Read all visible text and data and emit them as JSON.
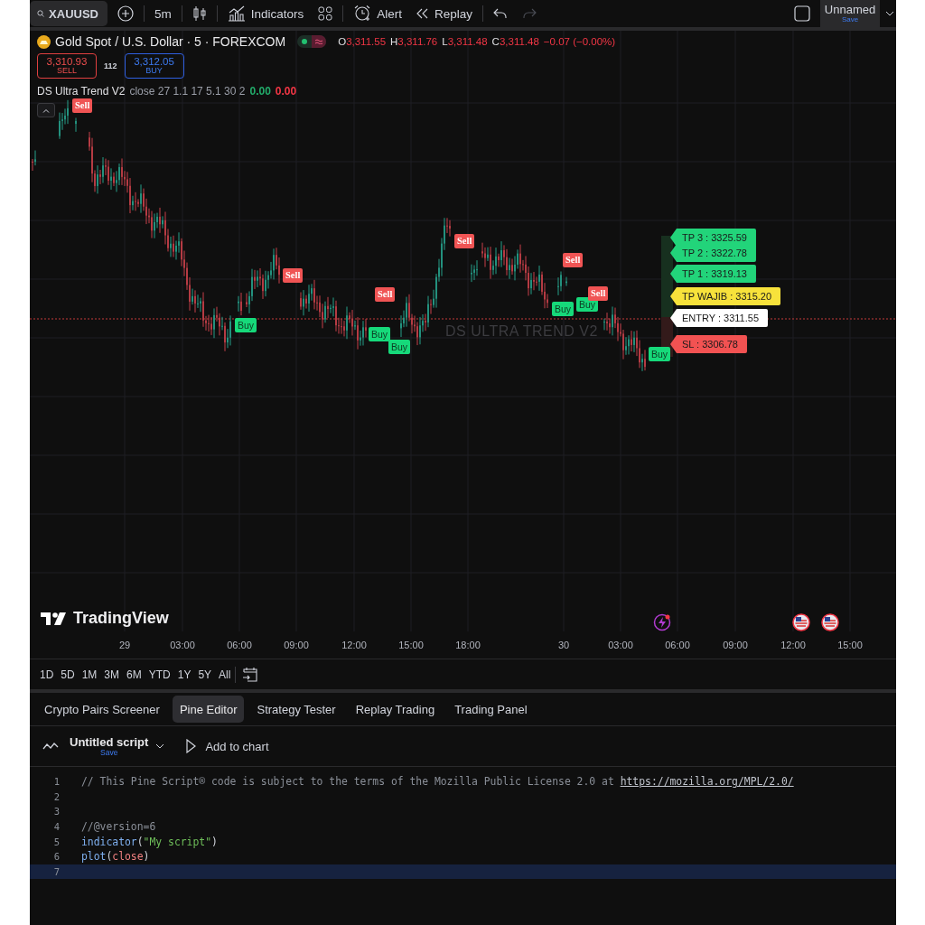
{
  "toolbar": {
    "symbol": "XAUUSD",
    "interval": "5m",
    "indicators": "Indicators",
    "alert": "Alert",
    "replay": "Replay",
    "redo_disabled": true,
    "layout_name": "Unnamed",
    "layout_save": "Save"
  },
  "legend": {
    "title": "Gold Spot / U.S. Dollar · 5 · FOREXCOM",
    "ohlc": [
      {
        "label": "O",
        "value": "3,311.55"
      },
      {
        "label": "H",
        "value": "3,311.76"
      },
      {
        "label": "L",
        "value": "3,311.48"
      },
      {
        "label": "C",
        "value": "3,311.48"
      }
    ],
    "change": "−0.07 (−0.00%)"
  },
  "trade": {
    "sell_price": "3,310.93",
    "sell_label": "SELL",
    "spread": "112",
    "buy_price": "3,312.05",
    "buy_label": "BUY"
  },
  "indicator": {
    "name": "DS Ultra Trend V2",
    "params": "close 27 1.1 17 5.1 30 2",
    "values": [
      {
        "text": "0.00",
        "color": "#22ab6a"
      },
      {
        "text": "0.00",
        "color": "#f23645"
      }
    ]
  },
  "chart": {
    "watermark": "DS ULTRA TREND V2",
    "brand": "TradingView",
    "signals": [
      {
        "kind": "sell",
        "label": "Sell"
      },
      {
        "kind": "buy",
        "label": "Buy"
      },
      {
        "kind": "sell",
        "label": "Sell"
      },
      {
        "kind": "buy",
        "label": "Buy"
      },
      {
        "kind": "sell",
        "label": "Sell"
      },
      {
        "kind": "buy",
        "label": "Buy"
      },
      {
        "kind": "sell",
        "label": "Sell"
      },
      {
        "kind": "buy",
        "label": "Buy"
      },
      {
        "kind": "sell",
        "label": "Sell"
      },
      {
        "kind": "buy",
        "label": "Buy"
      },
      {
        "kind": "sell",
        "label": "Sell"
      },
      {
        "kind": "buy",
        "label": "Buy"
      }
    ],
    "levels": [
      {
        "label": "TP 3 : 3325.59",
        "color": "#22d47a"
      },
      {
        "label": "TP 2 : 3322.78",
        "color": "#22d47a"
      },
      {
        "label": "TP 1 : 3319.13",
        "color": "#22d47a"
      },
      {
        "label": "TP WAJIB : 3315.20",
        "color": "#f7e23b"
      },
      {
        "label": "ENTRY : 3311.55",
        "color": "#ffffff"
      },
      {
        "label": "SL : 3306.78",
        "color": "#f25252"
      }
    ],
    "time_axis": [
      "29",
      "03:00",
      "06:00",
      "09:00",
      "12:00",
      "15:00",
      "18:00",
      "30",
      "03:00",
      "06:00",
      "09:00",
      "12:00",
      "15:00"
    ]
  },
  "ranges": [
    "1D",
    "5D",
    "1M",
    "3M",
    "6M",
    "YTD",
    "1Y",
    "5Y",
    "All"
  ],
  "panel_tabs": [
    {
      "label": "Crypto Pairs Screener",
      "selected": false
    },
    {
      "label": "Pine Editor",
      "selected": true
    },
    {
      "label": "Strategy Tester",
      "selected": false
    },
    {
      "label": "Replay Trading",
      "selected": false
    },
    {
      "label": "Trading Panel",
      "selected": false
    }
  ],
  "script": {
    "name": "Untitled script",
    "save": "Save",
    "add": "Add to chart"
  },
  "code": [
    {
      "number": "1",
      "active": false,
      "tokens": [
        {
          "kind": "comment",
          "text": "// This Pine Script® code is subject to the terms of the Mozilla Public License 2.0 at "
        },
        {
          "kind": "link",
          "text": "https://mozilla.org/MPL/2.0/"
        }
      ]
    },
    {
      "number": "2",
      "active": false
    },
    {
      "number": "3",
      "active": false
    },
    {
      "number": "4",
      "active": false,
      "tokens": [
        {
          "kind": "comment",
          "text": "//@version=6"
        }
      ]
    },
    {
      "number": "5",
      "active": false,
      "tokens": [
        {
          "kind": "function",
          "text": "indicator"
        },
        {
          "kind": "punct",
          "text": "("
        },
        {
          "kind": "string",
          "text": "\"My script\""
        },
        {
          "kind": "punct",
          "text": ")"
        }
      ]
    },
    {
      "number": "6",
      "active": false,
      "tokens": [
        {
          "kind": "function",
          "text": "plot"
        },
        {
          "kind": "punct",
          "text": "("
        },
        {
          "kind": "variable",
          "text": "close"
        },
        {
          "kind": "punct",
          "text": ")"
        }
      ]
    },
    {
      "number": "7",
      "active": true
    }
  ]
}
